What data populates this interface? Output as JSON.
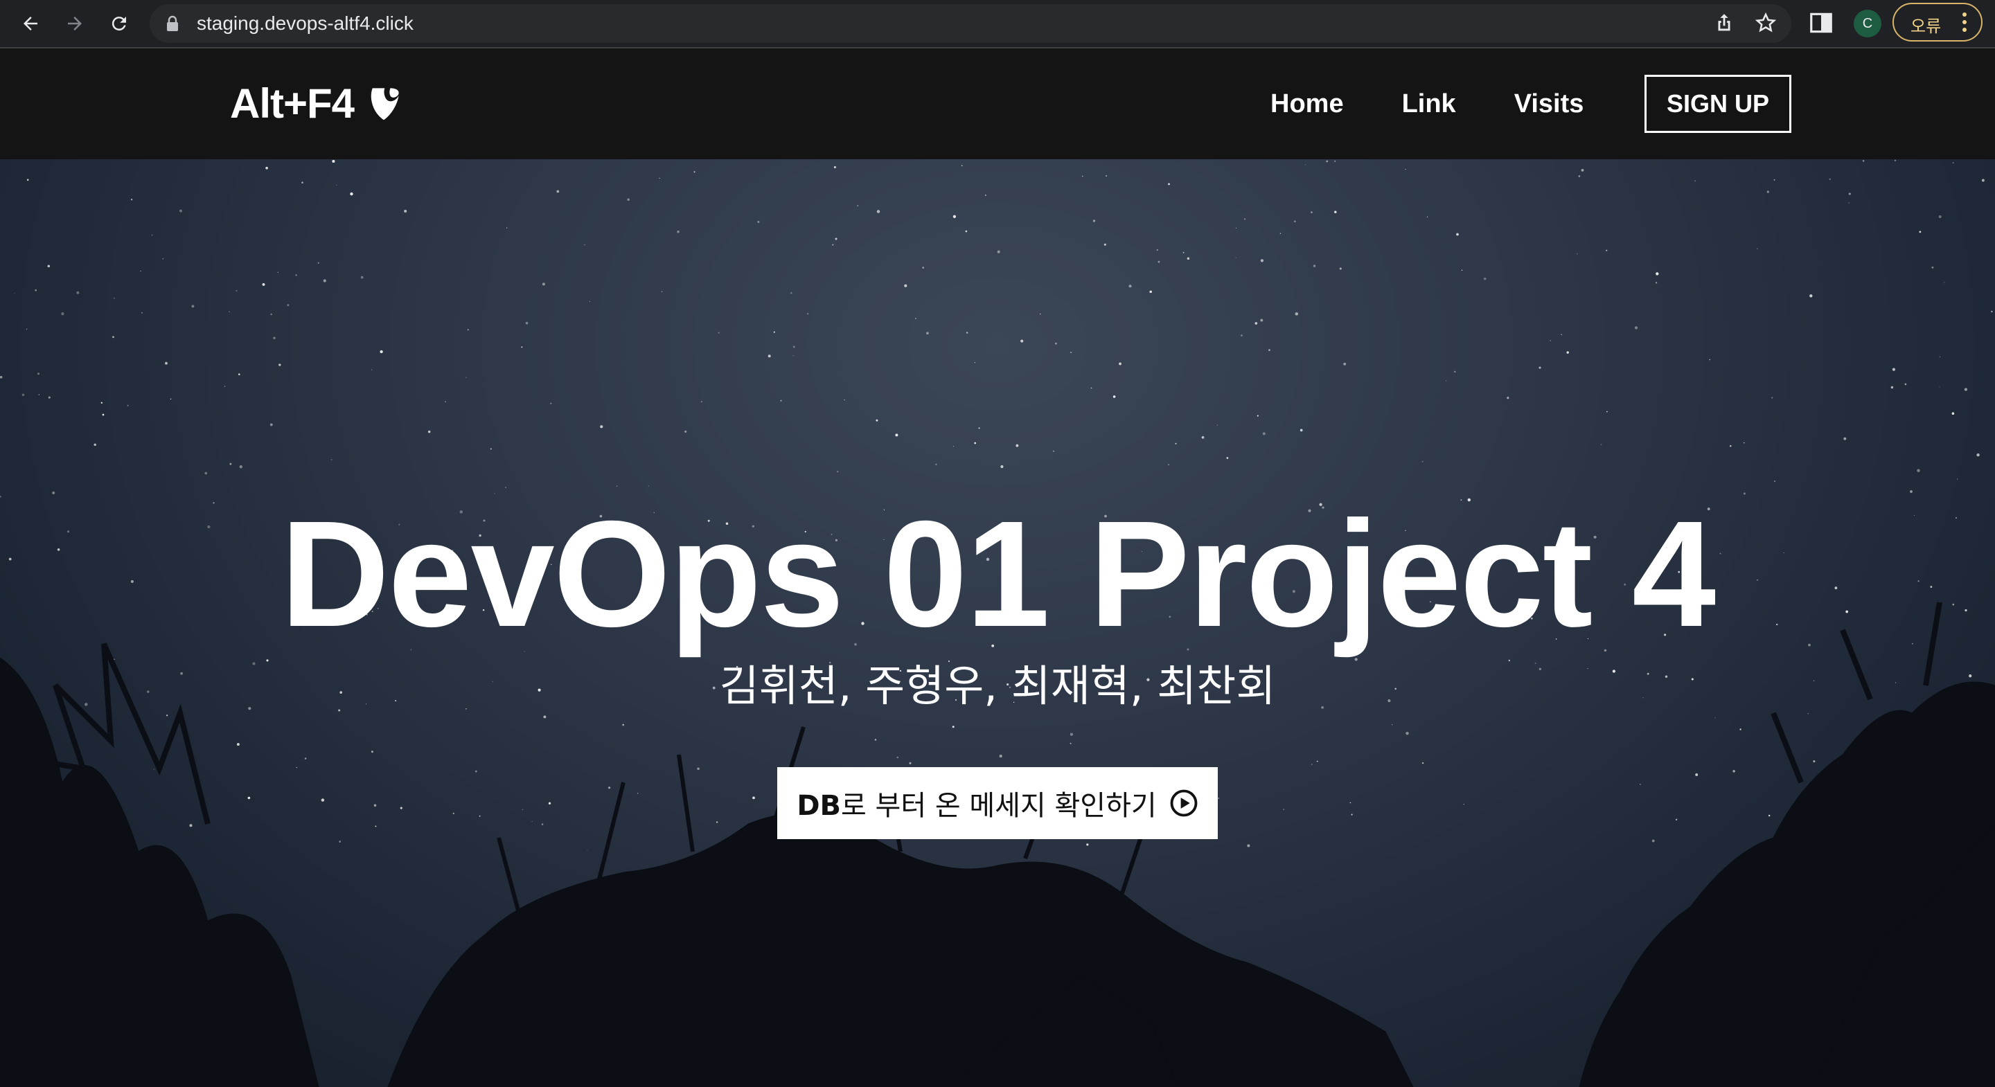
{
  "browser": {
    "url": "staging.devops-altf4.click",
    "profile_initial": "C",
    "error_label": "오류",
    "icons": [
      "back-arrow-icon",
      "forward-arrow-icon",
      "reload-icon",
      "lock-icon",
      "share-icon",
      "star-icon",
      "side-panel-icon",
      "more-vert-icon"
    ]
  },
  "site": {
    "brand": "Alt+F4",
    "nav": [
      "Home",
      "Link",
      "Visits"
    ],
    "signup": "SIGN UP"
  },
  "hero": {
    "title": "DevOps 01 Project 4",
    "subtitle": "김휘천, 주형우, 최재혁, 최찬회",
    "cta_bold": "DB",
    "cta_rest": "로 부터 온 메세지 확인하기",
    "cta_icon": "play-circle-icon"
  },
  "colors": {
    "chrome_bg": "#202124",
    "navbar_bg": "#141414",
    "error_accent": "#d9b56a"
  }
}
